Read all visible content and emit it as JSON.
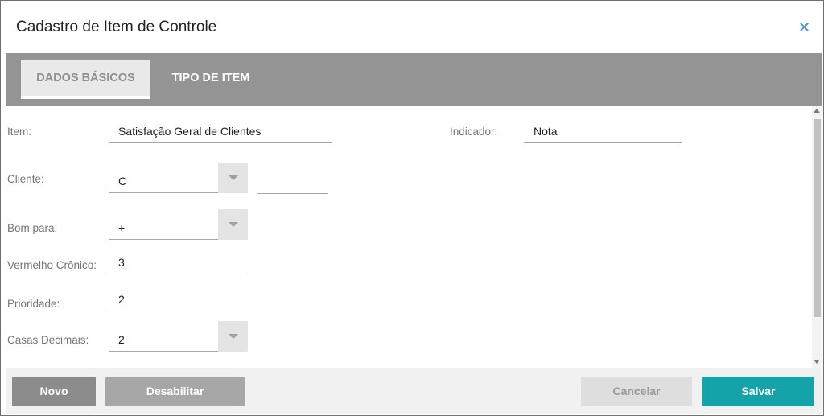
{
  "dialog": {
    "title": "Cadastro de Item de Controle",
    "close_icon": "close-icon",
    "accent_color": "#3a8fd6"
  },
  "tabs": [
    {
      "label": "DADOS BÁSICOS",
      "active": true
    },
    {
      "label": "TIPO DE ITEM",
      "active": false
    }
  ],
  "form": {
    "item": {
      "label": "Item:",
      "value": "Satisfação Geral de Clientes"
    },
    "indicador": {
      "label": "Indicador:",
      "value": "Nota"
    },
    "cliente": {
      "label": "Cliente:",
      "value": "C",
      "extra_value": ""
    },
    "bom_para": {
      "label": "Bom para:",
      "value": "+"
    },
    "vermelho_cronico": {
      "label": "Vermelho Crônico:",
      "value": "3"
    },
    "prioridade": {
      "label": "Prioridade:",
      "value": "2"
    },
    "casas_decimais": {
      "label": "Casas Decimais:",
      "value": "2"
    }
  },
  "footer": {
    "novo": "Novo",
    "desabilitar": "Desabilitar",
    "cancelar": "Cancelar",
    "salvar": "Salvar",
    "save_color": "#14a3a8"
  }
}
